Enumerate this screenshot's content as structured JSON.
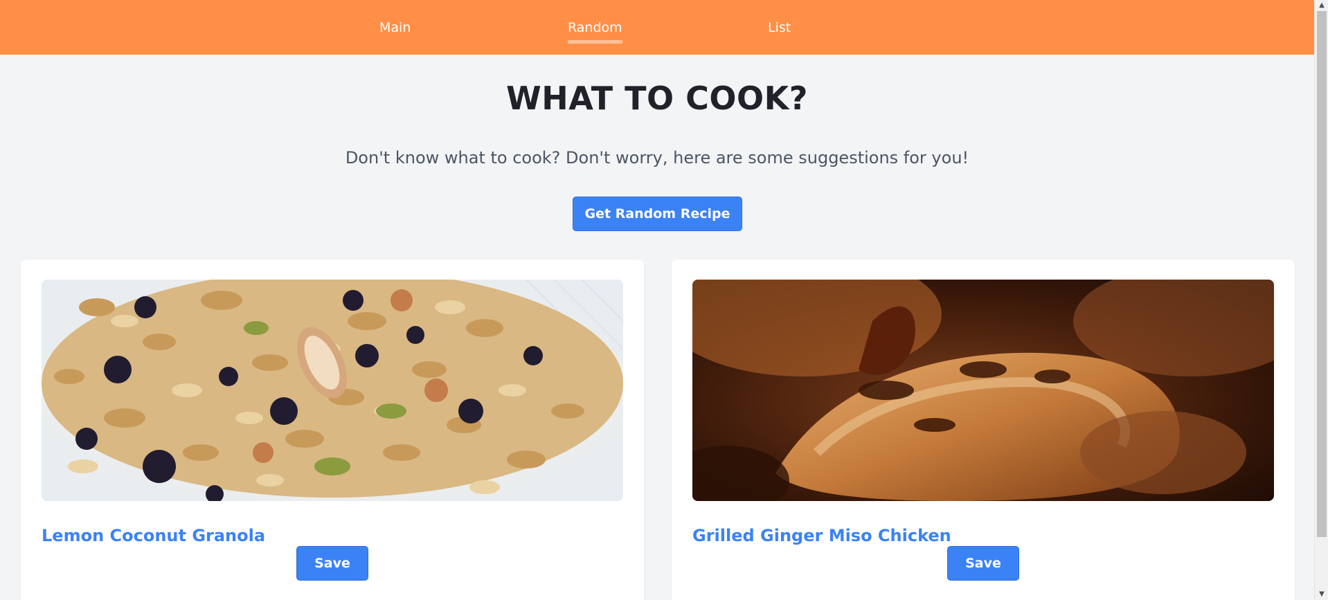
{
  "nav": {
    "items": [
      {
        "label": "Main"
      },
      {
        "label": "Random"
      },
      {
        "label": "List"
      }
    ],
    "active": "Random"
  },
  "header": {
    "title": "WHAT TO COOK?",
    "subtitle": "Don't know what to cook? Don't worry, here are some suggestions for you!"
  },
  "actions": {
    "random_label": "Get Random Recipe"
  },
  "recipes": [
    {
      "title": "Lemon Coconut Granola",
      "save_label": "Save",
      "image": "granola-photo"
    },
    {
      "title": "Grilled Ginger Miso Chicken",
      "save_label": "Save",
      "image": "grilled-chicken-photo"
    }
  ],
  "colors": {
    "navbar": "#ff8f47",
    "accent": "#3b82f6",
    "background": "#f3f4f6",
    "title_text": "#1f2329"
  },
  "icons": {
    "scroll_up": "chevron-up-icon",
    "scroll_down": "chevron-down-icon"
  }
}
